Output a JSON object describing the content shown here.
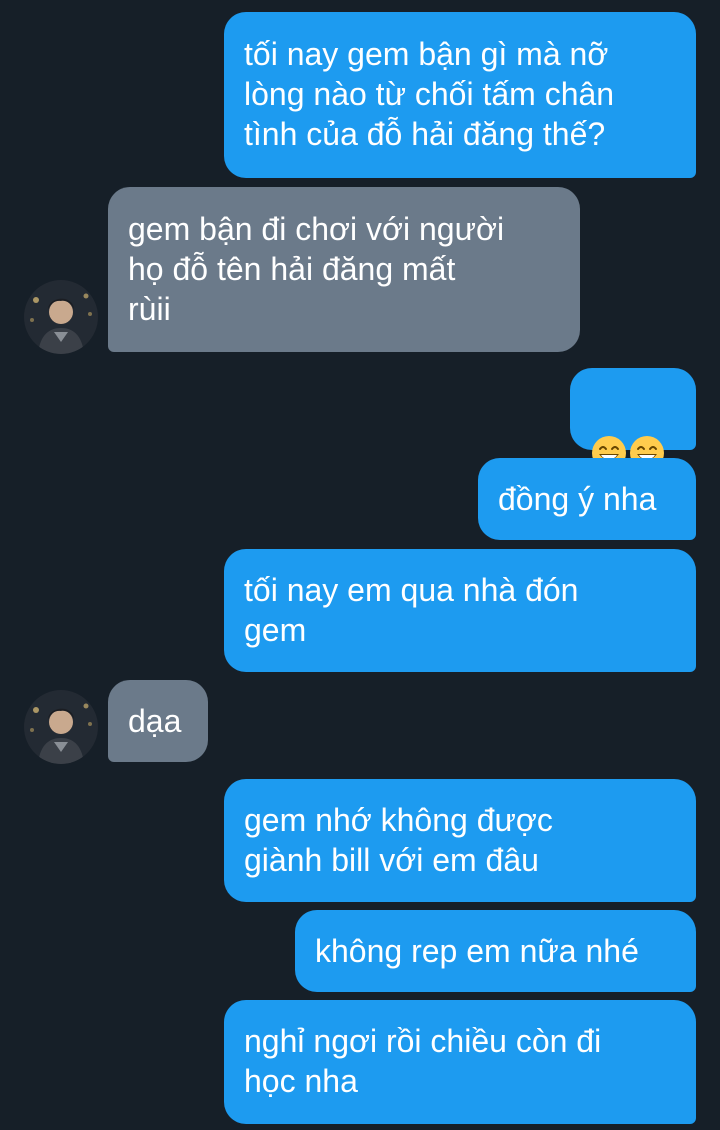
{
  "conversation": {
    "messages": [
      {
        "from": "me",
        "text": "tối nay gem bận gì mà nỡ\nlòng nào từ chối tấm chân\ntình của đỗ hải đăng thế?"
      },
      {
        "from": "them",
        "text": "gem bận đi chơi với người\nhọ đỗ tên hải đăng mất\nrùii"
      },
      {
        "from": "me",
        "emoji": [
          "grinning-face-smiling-eyes",
          "grinning-face-smiling-eyes"
        ]
      },
      {
        "from": "me",
        "text": "đồng ý nha"
      },
      {
        "from": "me",
        "text": "tối nay em qua nhà đón\ngem"
      },
      {
        "from": "them",
        "text": "dạa"
      },
      {
        "from": "me",
        "text": "gem nhớ không được\ngiành bill với em đâu"
      },
      {
        "from": "me",
        "text": "không rep em nữa nhé"
      },
      {
        "from": "me",
        "text": "nghỉ ngơi rồi chiều còn đi\nhọc nha"
      }
    ]
  },
  "colors": {
    "background": "#161f28",
    "outgoing_bubble": "#1d9bf0",
    "incoming_bubble": "#6b7a8a",
    "text": "#ffffff"
  }
}
